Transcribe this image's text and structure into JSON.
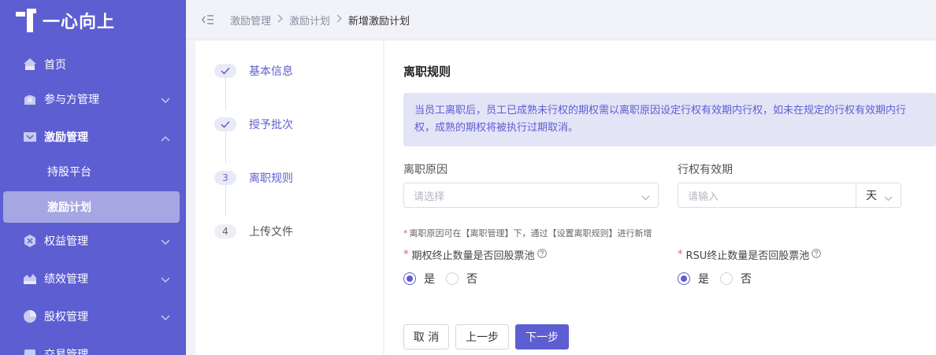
{
  "app": {
    "logo_text": "一心向上"
  },
  "sidebar": {
    "items": [
      {
        "label": "首页",
        "icon": "home-icon"
      },
      {
        "label": "参与方管理",
        "icon": "participants-icon"
      },
      {
        "label": "激励管理",
        "icon": "incentive-icon",
        "expanded": true
      },
      {
        "label": "权益管理",
        "icon": "equity-icon"
      },
      {
        "label": "绩效管理",
        "icon": "performance-icon"
      },
      {
        "label": "股权管理",
        "icon": "stock-icon"
      },
      {
        "label": "交易管理",
        "icon": "trade-icon"
      }
    ],
    "subitems": [
      {
        "label": "持股平台"
      },
      {
        "label": "激励计划",
        "active": true
      }
    ]
  },
  "breadcrumb": {
    "items": [
      "激励管理",
      "激励计划"
    ],
    "current": "新增激励计划"
  },
  "steps": [
    {
      "number": "",
      "label": "基本信息",
      "status": "done"
    },
    {
      "number": "",
      "label": "授予批次",
      "status": "done"
    },
    {
      "number": "3",
      "label": "离职规则",
      "status": "current"
    },
    {
      "number": "4",
      "label": "上传文件",
      "status": "pending"
    }
  ],
  "form": {
    "title": "离职规则",
    "notice": "当员工离职后，员工已成熟未行权的期权需以离职原因设定行权有效期内行权，如未在规定的行权有效期内行权，成熟的期权将被执行过期取消。",
    "leave_reason": {
      "label": "离职原因",
      "placeholder": "请选择"
    },
    "validity": {
      "label": "行权有效期",
      "placeholder": "请输入",
      "unit": "天"
    },
    "hint_mark": "*",
    "hint": "离职原因可在【离职管理】下，通过【设置离职规则】进行新增",
    "option_pool_question": {
      "required_mark": "*",
      "label": "期权终止数量是否回股票池",
      "yes": "是",
      "no": "否",
      "selected": "是"
    },
    "rsu_pool_question": {
      "required_mark": "*",
      "label": "RSU终止数量是否回股票池",
      "yes": "是",
      "no": "否",
      "selected": "是"
    },
    "buttons": {
      "cancel": "取 消",
      "prev": "上一步",
      "next": "下一步"
    }
  },
  "colors": {
    "accent": "#5d5ed1",
    "sidebar_bg": "#5d5ed1",
    "notice_bg": "#e4e4f7",
    "required": "#e45b5b"
  }
}
